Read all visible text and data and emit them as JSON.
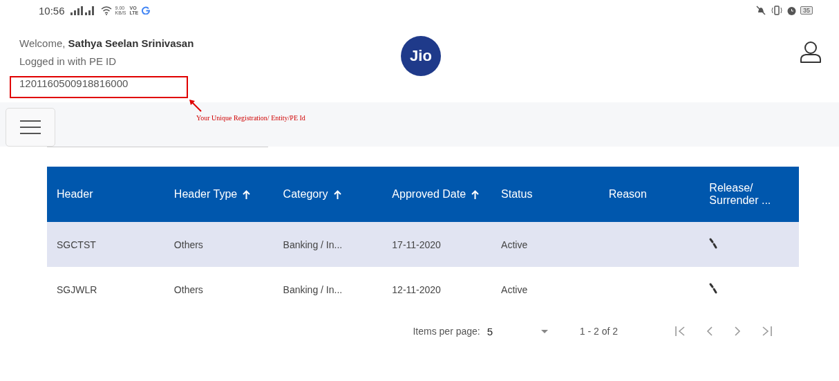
{
  "status_bar": {
    "time": "10:56",
    "speed": "9.00",
    "speed_unit": "KB/S",
    "network": "VO",
    "network_sub": "LTE",
    "battery": "35"
  },
  "header": {
    "welcome": "Welcome,",
    "user_name": "Sathya Seelan Srinivasan",
    "login_label": "Logged in with PE ID",
    "pe_id": "1201160500918816000",
    "logo": "Jio"
  },
  "annotation": {
    "text": "Your Unique Registration/ Entity/PE Id"
  },
  "table": {
    "columns": [
      {
        "label": "Header",
        "sort_arrow": false
      },
      {
        "label": "Header Type",
        "sort_arrow": true
      },
      {
        "label": "Category",
        "sort_arrow": true
      },
      {
        "label": "Approved Date",
        "sort_arrow": true
      },
      {
        "label": "Status",
        "sort_arrow": false
      },
      {
        "label": "Reason",
        "sort_arrow": false
      },
      {
        "label": "Release/ Surrender ...",
        "sort_arrow": false
      }
    ],
    "rows": [
      {
        "selected": true,
        "cells": [
          "SGCTST",
          "Others",
          "Banking / In...",
          "17-11-2020",
          "Active",
          ""
        ]
      },
      {
        "selected": false,
        "cells": [
          "SGJWLR",
          "Others",
          "Banking / In...",
          "12-11-2020",
          "Active",
          ""
        ]
      }
    ]
  },
  "paginator": {
    "label": "Items per page:",
    "page_size": "5",
    "range": "1 - 2 of 2"
  }
}
